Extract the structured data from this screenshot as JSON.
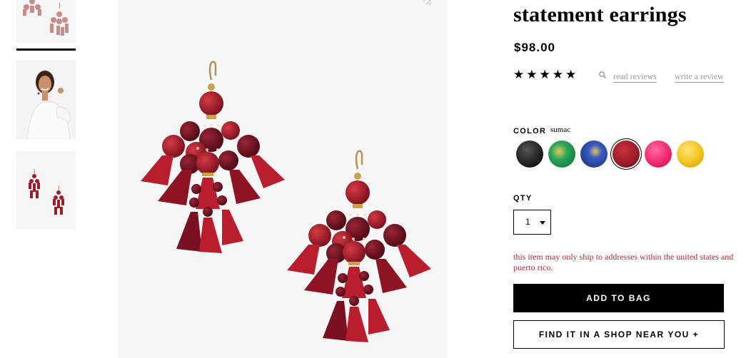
{
  "product": {
    "title": "statement earrings",
    "price": "$98.00",
    "rating_stars": [
      "★",
      "★",
      "★",
      "★",
      "★"
    ],
    "read_reviews": "read reviews",
    "write_review": "write a review"
  },
  "color": {
    "label": "COLOR",
    "selected": "sumac",
    "swatches": [
      {
        "name": "black",
        "hex": "#1f1f1f"
      },
      {
        "name": "green",
        "hex": "#1e9a52"
      },
      {
        "name": "blue",
        "hex": "#1f3f9a"
      },
      {
        "name": "sumac",
        "hex": "#9e1c28"
      },
      {
        "name": "pink",
        "hex": "#f0286e"
      },
      {
        "name": "yellow",
        "hex": "#f2c11c"
      }
    ]
  },
  "quantity": {
    "label": "QTY",
    "value": "1"
  },
  "shipping_note": "this item may only ship to addresses within the united states and puerto rico.",
  "buttons": {
    "add_to_bag": "ADD TO BAG",
    "find_in_shop": "FIND IT IN A SHOP NEAR YOU +"
  },
  "icons": {
    "search": "magnifier-icon",
    "expand": "expand-icon",
    "dropdown": "chevron-down-icon"
  },
  "colors": {
    "accent_red": "#b02a30",
    "earring_red": "#a61d2b",
    "earring_dark": "#6e1020",
    "gold": "#c9a24a"
  }
}
